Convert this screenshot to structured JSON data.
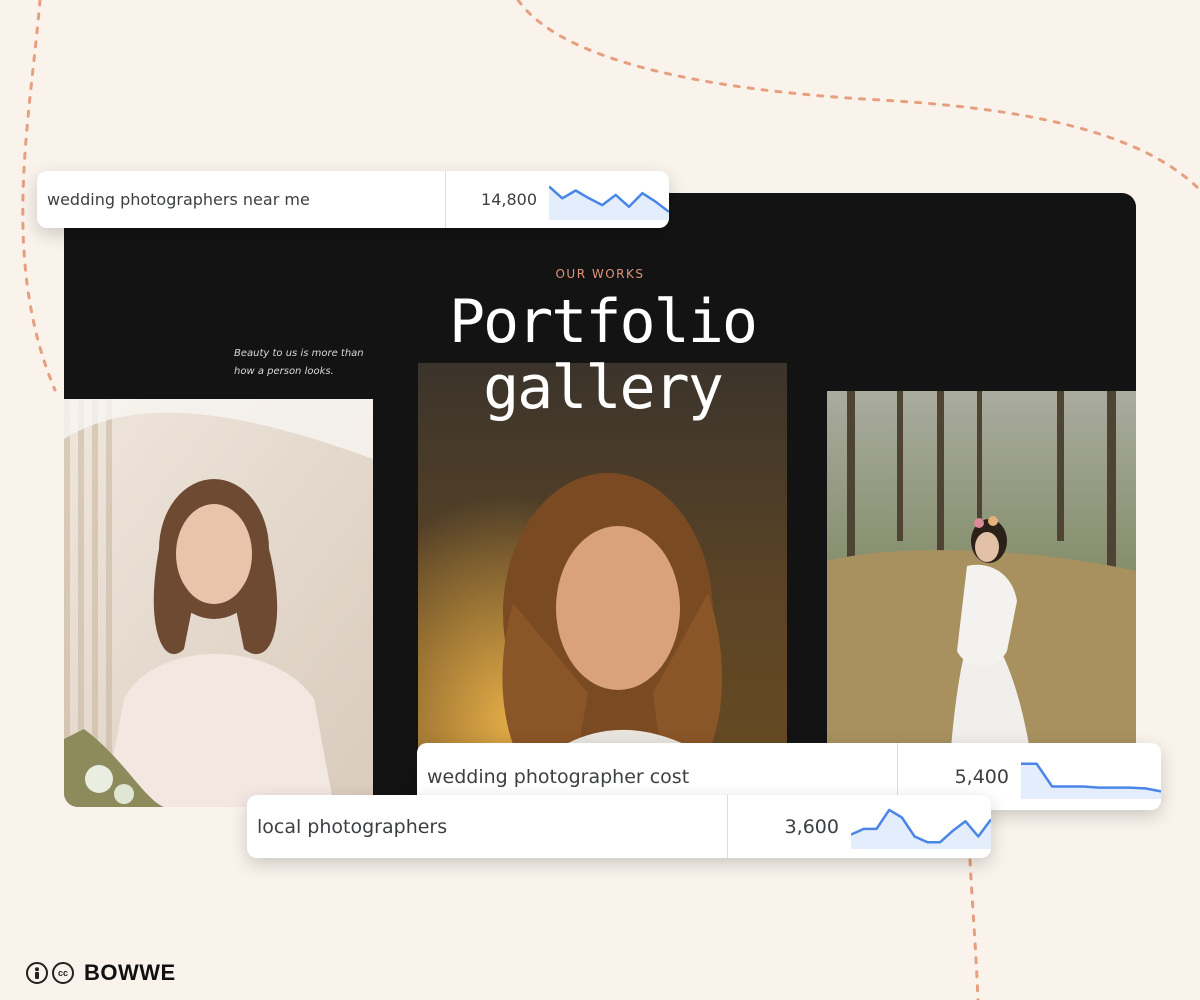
{
  "hero": {
    "eyebrow": "OUR WORKS",
    "title_line1": "Portfolio",
    "title_line2": "gallery",
    "tagline_line1": "Beauty to us is more than",
    "tagline_line2": "how a person looks."
  },
  "keywords": [
    {
      "term": "wedding photographers near me",
      "volume": "14,800",
      "trend": [
        0.9,
        0.55,
        0.78,
        0.55,
        0.35,
        0.65,
        0.3,
        0.7,
        0.45,
        0.15
      ]
    },
    {
      "term": "wedding photographer cost",
      "volume": "5,400",
      "trend": [
        0.85,
        0.85,
        0.25,
        0.25,
        0.25,
        0.22,
        0.22,
        0.22,
        0.2,
        0.12
      ]
    },
    {
      "term": "local photographers",
      "volume": "3,600",
      "trend": [
        0.3,
        0.45,
        0.45,
        0.95,
        0.75,
        0.25,
        0.1,
        0.1,
        0.4,
        0.65,
        0.25,
        0.7
      ]
    }
  ],
  "colors": {
    "page_bg": "#f9f3ec",
    "hero_bg": "#131313",
    "accent": "#e0937a",
    "sparkline": "#4a86e8",
    "sparkline_fill": "#e3edfc"
  },
  "brand": {
    "icon_1": "by-person-icon",
    "icon_2": "cc-icon",
    "icon_2_text": "cc",
    "name": "BOWWE"
  }
}
